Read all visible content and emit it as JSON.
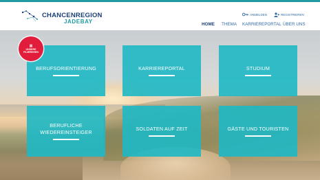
{
  "header": {
    "logo": {
      "line1": "CHANCENREGION",
      "line2": "JADEBAY",
      "alt": "Chancenregion JadeBay"
    },
    "auth": {
      "login": "ANMELDEN",
      "register": "REGISTRIEREN"
    },
    "nav": [
      {
        "label": "HOME",
        "active": true
      },
      {
        "label": "THEMA",
        "active": false
      },
      {
        "label": "KARRIEREPORTAL",
        "active": false
      },
      {
        "label": "ÜBER UNS",
        "active": false
      }
    ]
  },
  "badge": {
    "icon": "film-icon",
    "text": "UNSERE\nFILMREIHEN"
  },
  "tiles": [
    {
      "label": "BERUFSORIENTIERUNG"
    },
    {
      "label": "KARRIEREPORTAL"
    },
    {
      "label": "STUDIUM"
    },
    {
      "label": "BERUFLICHE\nWIEDEREINSTEIGER"
    },
    {
      "label": "SOLDATEN AUF ZEIT"
    },
    {
      "label": "GÄSTE UND TOURISTEN"
    }
  ],
  "colors": {
    "primary": "#1b3f77",
    "accent": "#1f9aa3",
    "tile": "#1eb8c4",
    "badge": "#e21d3b",
    "link": "#2f6aa8"
  }
}
